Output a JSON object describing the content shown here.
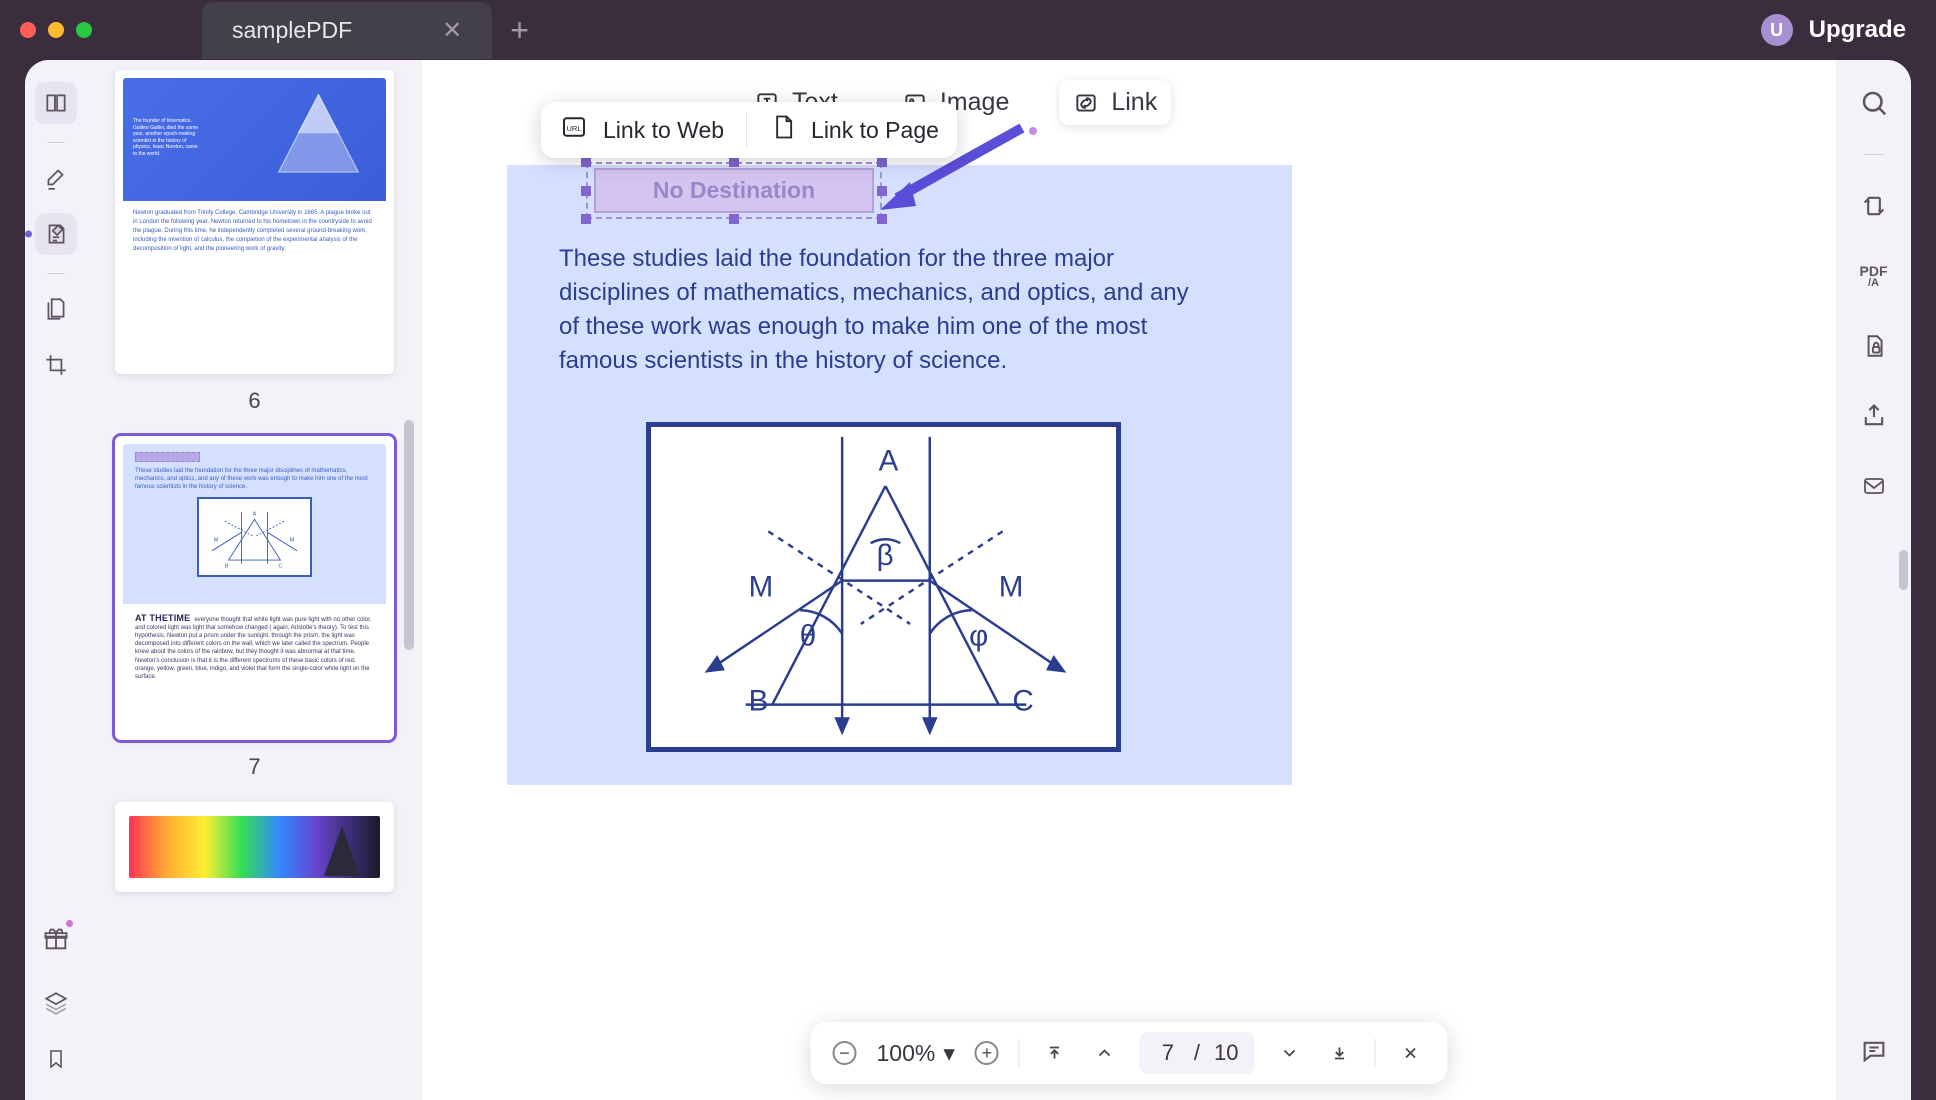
{
  "titlebar": {
    "tab_title": "samplePDF",
    "upgrade_label": "Upgrade",
    "upgrade_initial": "U"
  },
  "top_toolbar": {
    "text_label": "Text",
    "image_label": "Image",
    "link_label": "Link"
  },
  "link_menu": {
    "web": "Link to Web",
    "page": "Link to Page"
  },
  "annotation": {
    "no_destination": "No Destination"
  },
  "paragraph": "These studies laid the foundation for the three major disciplines of mathematics, mechanics, and optics, and any of these work was enough to make him one of the most famous scientists in the history of science.",
  "diagram": {
    "A": "A",
    "B": "B",
    "C": "C",
    "M1": "M",
    "M2": "M",
    "beta": "β",
    "theta": "θ",
    "phi": "φ"
  },
  "thumbs": {
    "p6": {
      "num": "6",
      "body": "Newton graduated from Trinity College, Cambridge University in 1665. A plague broke out in London the following year. Newton returned to his hometown in the countryside to avoid the plague. During this time, he independently completed several ground-breaking work, including the invention of calculus, the completion of the experimental analysis of the decomposition of light, and the pioneering work of gravity."
    },
    "p7": {
      "num": "7",
      "text": "These studies laid the foundation for the three major disciplines of mathematics, mechanics, and optics, and any of these work was enough to make him one of the most famous scientists in the history of science.",
      "heading": "AT THETIME",
      "body": "everyone thought that white light was pure light with no other color, and colored light was light that somehow changed ( again, Aristotle's theory). To test this hypothesis, Newton put a prism under the sunlight, through the prism, the light was decomposed into different colors on the wall, which we later called the spectrum. People knew about the colors of the rainbow, but they thought it was abnormal at that time. Newton's conclusion is that it is the different spectrums of these basic colors of red, orange, yellow, green, blue, indigo, and violet that form the single-color white light on the surface."
    }
  },
  "bottom_bar": {
    "zoom": "100%",
    "current_page": "7",
    "sep": "/",
    "total_pages": "10"
  }
}
